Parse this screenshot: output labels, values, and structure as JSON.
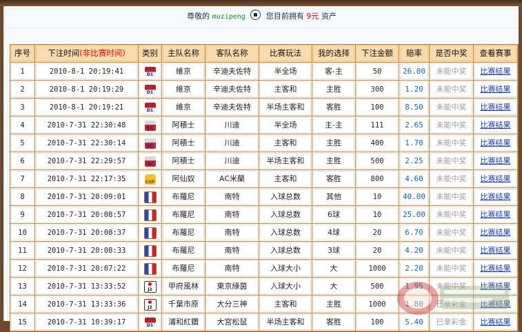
{
  "status": {
    "greeting": "尊敬的",
    "username": "muzipeng",
    "assets_prefix": "您目前拥有",
    "amount": "9元",
    "assets_suffix": "资产"
  },
  "columns": {
    "seq": "序号",
    "time_a": "下注时间",
    "time_b": "(非比赛时间)",
    "type": "类别",
    "home": "主队名称",
    "away": "客队名称",
    "play": "比赛玩法",
    "choice": "我的选择",
    "amount": "下注金额",
    "odds": "赔率",
    "win": "是否中奖",
    "view": "查看赛事"
  },
  "badges": {
    "d1": "D1",
    "sc": "SC",
    "cup": "CUP",
    "fr": "",
    "j2": "J2"
  },
  "rows": [
    {
      "seq": "1",
      "time": "2010-8-1 20:19:41",
      "type": "d1",
      "home": "維京",
      "away": "辛迪夫佐特",
      "play": "半全场",
      "choice": "客-主",
      "amount": "50",
      "odds": "26.00",
      "win": "未能中奖",
      "view": "比赛结果"
    },
    {
      "seq": "2",
      "time": "2010-8-1 20:19:29",
      "type": "d1",
      "home": "維京",
      "away": "辛迪夫佐特",
      "play": "主客和",
      "choice": "主胜",
      "amount": "300",
      "odds": "1.20",
      "win": "未能中奖",
      "view": "比赛结果"
    },
    {
      "seq": "3",
      "time": "2010-8-1 20:19:21",
      "type": "d1",
      "home": "維京",
      "away": "辛迪夫佐特",
      "play": "半场主客和",
      "choice": "客胜",
      "amount": "100",
      "odds": "8.50",
      "win": "未能中奖",
      "view": "比赛结果"
    },
    {
      "seq": "4",
      "time": "2010-7-31 22:30:48",
      "type": "sc",
      "home": "阿積士",
      "away": "川迪",
      "play": "半全场",
      "choice": "主-主",
      "amount": "111",
      "odds": "2.65",
      "win": "未能中奖",
      "view": "比赛结果"
    },
    {
      "seq": "5",
      "time": "2010-7-31 22:30:14",
      "type": "sc",
      "home": "阿積士",
      "away": "川迪",
      "play": "主客和",
      "choice": "主胜",
      "amount": "400",
      "odds": "1.70",
      "win": "未能中奖",
      "view": "比赛结果"
    },
    {
      "seq": "6",
      "time": "2010-7-31 22:29:57",
      "type": "sc",
      "home": "阿積士",
      "away": "川迪",
      "play": "半场主客和",
      "choice": "主胜",
      "amount": "500",
      "odds": "2.25",
      "win": "未能中奖",
      "view": "比赛结果"
    },
    {
      "seq": "7",
      "time": "2010-7-31 22:17:35",
      "type": "cup",
      "home": "阿仙奴",
      "away": "AC米蘭",
      "play": "主客和",
      "choice": "客胜",
      "amount": "800",
      "odds": "4.60",
      "win": "未能中奖",
      "view": "比赛结果"
    },
    {
      "seq": "8",
      "time": "2010-7-31 20:09:01",
      "type": "fr",
      "home": "布羅尼",
      "away": "南特",
      "play": "入球总数",
      "choice": "其他",
      "amount": "10",
      "odds": "40.00",
      "win": "未能中奖",
      "view": "比赛结果"
    },
    {
      "seq": "9",
      "time": "2010-7-31 20:08:57",
      "type": "fr",
      "home": "布羅尼",
      "away": "南特",
      "play": "入球总数",
      "choice": "6球",
      "amount": "10",
      "odds": "25.00",
      "win": "未能中奖",
      "view": "比赛结果"
    },
    {
      "seq": "10",
      "time": "2010-7-31 20:08:37",
      "type": "fr",
      "home": "布羅尼",
      "away": "南特",
      "play": "入球总数",
      "choice": "4球",
      "amount": "20",
      "odds": "6.70",
      "win": "未能中奖",
      "view": "比赛结果"
    },
    {
      "seq": "11",
      "time": "2010-7-31 20:08:33",
      "type": "fr",
      "home": "布羅尼",
      "away": "南特",
      "play": "入球总数",
      "choice": "3球",
      "amount": "20",
      "odds": "4.20",
      "win": "未能中奖",
      "view": "比赛结果"
    },
    {
      "seq": "12",
      "time": "2010-7-31 20:07:22",
      "type": "fr",
      "home": "布羅尼",
      "away": "南特",
      "play": "入球大小",
      "choice": "大",
      "amount": "1000",
      "odds": "2.20",
      "win": "未能中奖",
      "view": "比赛结果"
    },
    {
      "seq": "13",
      "time": "2010-7-31 13:33:52",
      "type": "j2",
      "home": "甲府風林",
      "away": "東京綠茵",
      "play": "入球大小",
      "choice": "大",
      "amount": "500",
      "odds": "1.95",
      "win": "未能中奖",
      "view": "比赛结果"
    },
    {
      "seq": "14",
      "time": "2010-7-31 13:33:36",
      "type": "j2",
      "home": "千葉市原",
      "away": "大分三神",
      "play": "主客和",
      "choice": "主胜",
      "amount": "1000",
      "odds": "1.80",
      "win": "已拿彩金",
      "view": "比赛结果"
    },
    {
      "seq": "15",
      "time": "2010-7-31 10:39:17",
      "type": "d1",
      "home": "浦和紅鑽",
      "away": "大宮松鼠",
      "play": "半场主客和",
      "choice": "客胜",
      "amount": "100",
      "odds": "5.40",
      "win": "已拿彩金",
      "view": "比赛结果"
    }
  ]
}
